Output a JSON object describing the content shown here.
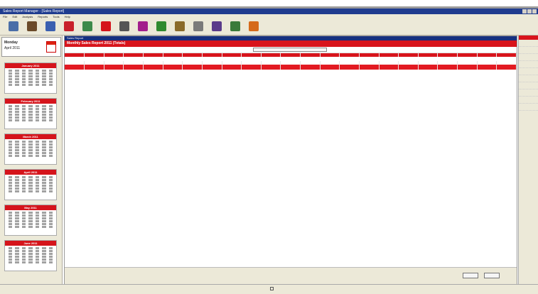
{
  "window": {
    "title": "Sales Report Manager - [Sales Report]"
  },
  "menu": [
    "File",
    "Edit",
    "Analysis",
    "Reports",
    "Tools",
    "Help"
  ],
  "toolbar": {
    "items": [
      {
        "icon": "monitor-icon",
        "label": "",
        "color": "#4a6ea8"
      },
      {
        "icon": "door-icon",
        "label": "",
        "color": "#6b4a2a"
      },
      {
        "icon": "printer-icon",
        "label": "",
        "color": "#3a5fb0"
      },
      {
        "icon": "alert-icon",
        "label": "",
        "color": "#c8202a"
      },
      {
        "icon": "chart-icon",
        "label": "",
        "color": "#3c8a4a"
      },
      {
        "icon": "document-icon",
        "label": "",
        "color": "#d5141b"
      },
      {
        "icon": "people-icon",
        "label": "",
        "color": "#555555"
      },
      {
        "icon": "figure-icon",
        "label": "",
        "color": "#a21f8c"
      },
      {
        "icon": "filter-icon",
        "label": "",
        "color": "#2f8a2f"
      },
      {
        "icon": "grid-icon",
        "label": "",
        "color": "#8a6a2a"
      },
      {
        "icon": "stack-icon",
        "label": "",
        "color": "#7a7a7a"
      },
      {
        "icon": "gauge-icon",
        "label": "",
        "color": "#5a3a8a"
      },
      {
        "icon": "globe-icon",
        "label": "",
        "color": "#3a7a3a"
      },
      {
        "icon": "book-icon",
        "label": "",
        "color": "#d56a1b"
      }
    ]
  },
  "left": {
    "today_day": "Monday",
    "today_date": "April 2011",
    "calendars": [
      {
        "month": "January 2011"
      },
      {
        "month": "February 2011"
      },
      {
        "month": "March 2011"
      },
      {
        "month": "April 2011"
      },
      {
        "month": "May 2011"
      },
      {
        "month": "June 2011"
      }
    ]
  },
  "main": {
    "title": "Sales Report",
    "header": "Monthly Sales Report 2011 (Totals)",
    "header_right": "",
    "filter_value": "",
    "columns": [
      "",
      "",
      "",
      "",
      "",
      "",
      "",
      "",
      "",
      "",
      "",
      "",
      "",
      "",
      "",
      "",
      "",
      "",
      "",
      "",
      "",
      "",
      ""
    ],
    "sections": [
      {
        "name": "",
        "rows": [
          [
            "",
            "",
            "",
            "",
            "",
            "",
            "",
            "",
            "",
            "",
            "",
            "",
            "",
            "",
            "",
            "",
            "",
            "",
            "",
            "",
            "",
            "",
            ""
          ]
        ],
        "total": [
          "",
          "",
          "",
          "",
          "",
          "",
          "",
          "",
          "",
          "",
          "",
          "",
          "",
          "",
          "",
          "",
          "",
          "",
          "",
          "",
          "",
          "",
          ""
        ]
      }
    ],
    "status_message": "",
    "ok_label": "",
    "cancel_label": ""
  },
  "right": {
    "header": "",
    "items": [
      "",
      "",
      "",
      "",
      "",
      "",
      "",
      "",
      "",
      ""
    ]
  },
  "footer": {
    "checkbox_label": ""
  }
}
